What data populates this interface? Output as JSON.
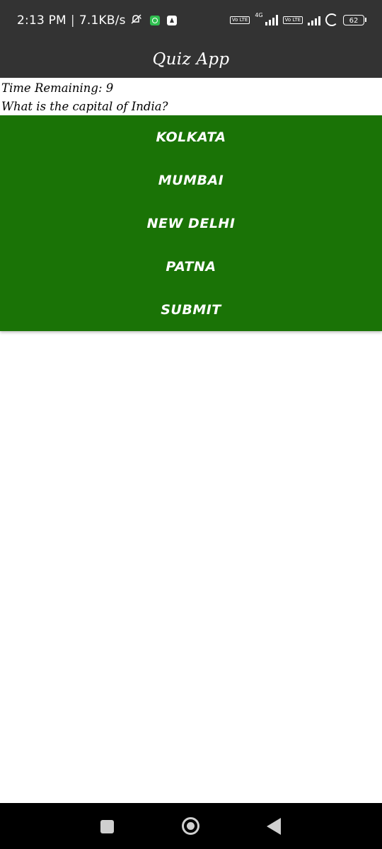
{
  "status_bar": {
    "time": "2:13 PM",
    "separator": "|",
    "network_speed": "7.1KB/s",
    "network_type": "4G",
    "sim1_label": "Vo LTE",
    "sim2_label": "Vo LTE",
    "battery_level": "62",
    "icons": [
      "mute-icon",
      "whatsapp-icon",
      "notification-app-icon",
      "volte-icon",
      "signal-icon",
      "sync-icon",
      "battery-icon"
    ]
  },
  "app_bar": {
    "title": "Quiz App"
  },
  "quiz": {
    "timer_label": "Time Remaining: 9",
    "question": "What is the capital of India?",
    "options": [
      {
        "label": "KOLKATA"
      },
      {
        "label": "MUMBAI"
      },
      {
        "label": "NEW DELHI"
      },
      {
        "label": "PATNA"
      }
    ],
    "submit_label": "SUBMIT"
  },
  "colors": {
    "app_bar_bg": "#333333",
    "options_panel_bg": "#1a7306",
    "text_on_green": "#ffffff",
    "nav_bar_bg": "#000000"
  },
  "nav_bar": {
    "icons": [
      "recent-apps-icon",
      "home-icon",
      "back-icon"
    ]
  }
}
